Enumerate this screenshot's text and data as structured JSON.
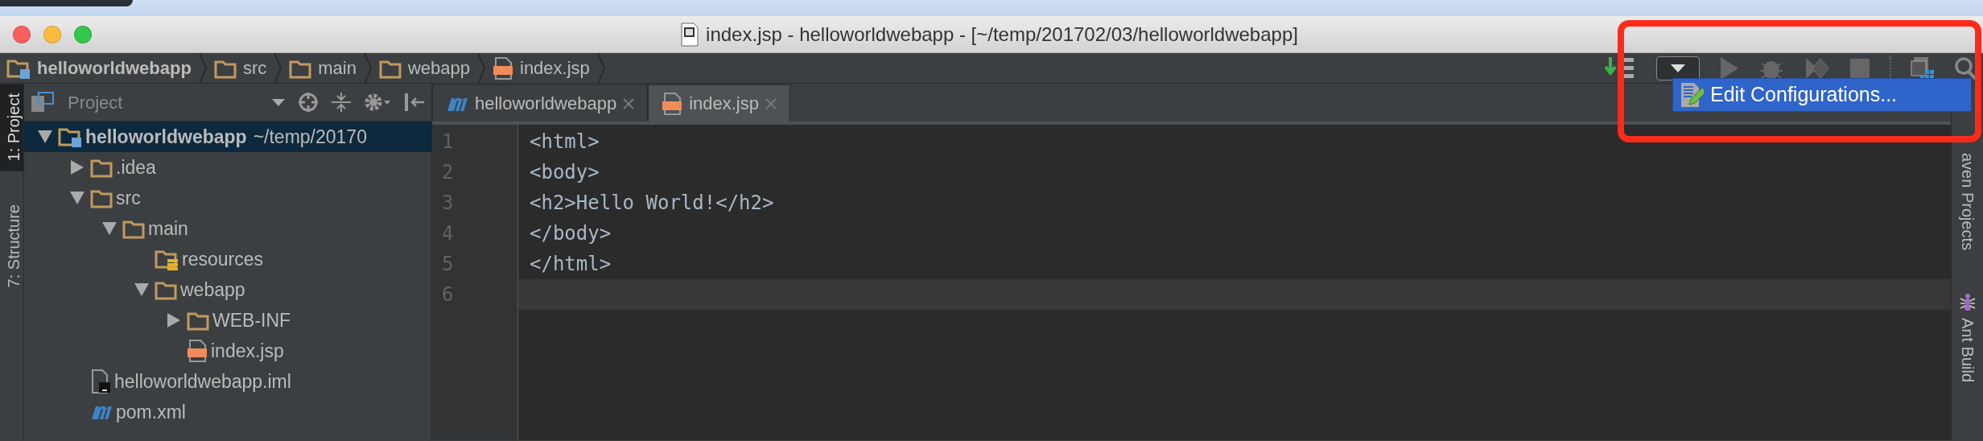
{
  "window": {
    "title": "index.jsp - helloworldwebapp - [~/temp/201702/03/helloworldwebapp]"
  },
  "breadcrumbs": [
    {
      "label": "helloworldwebapp",
      "kind": "module"
    },
    {
      "label": "src",
      "kind": "folder"
    },
    {
      "label": "main",
      "kind": "folder"
    },
    {
      "label": "webapp",
      "kind": "folder"
    },
    {
      "label": "index.jsp",
      "kind": "jsp"
    }
  ],
  "run_menu": {
    "open": true,
    "items": [
      {
        "label": "Edit Configurations...",
        "selected": true
      }
    ]
  },
  "left_tool_strip": [
    {
      "label": "1: Project",
      "selected": true
    },
    {
      "label": "7: Structure",
      "selected": false
    }
  ],
  "project_panel": {
    "view": "Project",
    "tree": [
      {
        "label": "helloworldwebapp",
        "detail": "~/temp/20170",
        "kind": "module",
        "expanded": true,
        "selected": true,
        "children": [
          {
            "label": ".idea",
            "kind": "folder",
            "expanded": false,
            "selected": false
          },
          {
            "label": "src",
            "kind": "folder",
            "expanded": true,
            "selected": false,
            "children": [
              {
                "label": "main",
                "kind": "folder",
                "expanded": true,
                "selected": false,
                "children": [
                  {
                    "label": "resources",
                    "kind": "resources",
                    "selected": false
                  },
                  {
                    "label": "webapp",
                    "kind": "folder",
                    "expanded": true,
                    "selected": false,
                    "children": [
                      {
                        "label": "WEB-INF",
                        "kind": "folder",
                        "expanded": false,
                        "selected": false
                      },
                      {
                        "label": "index.jsp",
                        "kind": "jsp",
                        "selected": false
                      }
                    ]
                  }
                ]
              }
            ]
          },
          {
            "label": "helloworldwebapp.iml",
            "kind": "iml",
            "selected": false
          },
          {
            "label": "pom.xml",
            "kind": "maven",
            "selected": false
          }
        ]
      }
    ]
  },
  "editor": {
    "tabs": [
      {
        "label": "helloworldwebapp",
        "kind": "maven",
        "selected": false
      },
      {
        "label": "index.jsp",
        "kind": "jsp",
        "selected": true
      }
    ],
    "lines": [
      {
        "number": "1",
        "code": "<html>",
        "current": false
      },
      {
        "number": "2",
        "code": "<body>",
        "current": false
      },
      {
        "number": "3",
        "code": "<h2>Hello World!</h2>",
        "current": false
      },
      {
        "number": "4",
        "code": "</body>",
        "current": false
      },
      {
        "number": "5",
        "code": "</html>",
        "current": false
      },
      {
        "number": "6",
        "current": true
      }
    ]
  },
  "right_tool_strip": [
    {
      "label": "aven Projects",
      "kind": "plain"
    },
    {
      "label": "Ant Build",
      "kind": "ant"
    }
  ],
  "annotation": {
    "kind": "frame"
  }
}
